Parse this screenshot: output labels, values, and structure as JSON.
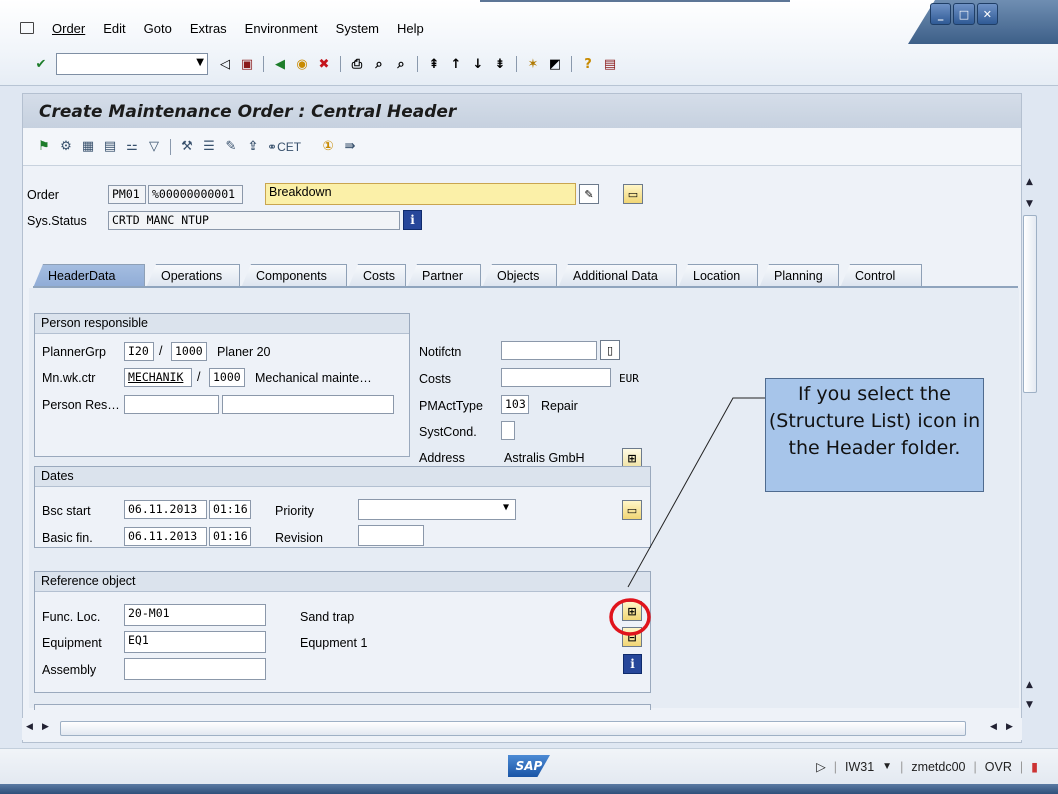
{
  "menu": {
    "items": [
      "Order",
      "Edit",
      "Goto",
      "Extras",
      "Environment",
      "System",
      "Help"
    ]
  },
  "title": "Create Maintenance Order : Central Header",
  "toolbar2": {
    "cet_label": "CET"
  },
  "header": {
    "order_label": "Order",
    "order_type": "PM01",
    "order_number": "%00000000001",
    "order_desc": "Breakdown",
    "sys_status_label": "Sys.Status",
    "sys_status": "CRTD MANC NTUP"
  },
  "tabs": [
    "HeaderData",
    "Operations",
    "Components",
    "Costs",
    "Partner",
    "Objects",
    "Additional Data",
    "Location",
    "Planning",
    "Control"
  ],
  "person_responsible": {
    "title": "Person responsible",
    "planner_grp_label": "PlannerGrp",
    "planner_grp": "I20",
    "planner_plant": "1000",
    "planner_text": "Planer 20",
    "mn_wk_ctr_label": "Mn.wk.ctr",
    "mn_wk_ctr": "MECHANIK",
    "mn_wk_plant": "1000",
    "mn_wk_text": "Mechanical mainte…",
    "person_res_label": "Person Res…"
  },
  "right_fields": {
    "notifctn_label": "Notifctn",
    "costs_label": "Costs",
    "costs_currency": "EUR",
    "pmacttype_label": "PMActType",
    "pmacttype": "103",
    "pmacttype_text": "Repair",
    "systcond_label": "SystCond.",
    "address_label": "Address",
    "address_value": "Astralis GmbH"
  },
  "dates": {
    "title": "Dates",
    "bsc_start_label": "Bsc start",
    "bsc_start_date": "06.11.2013",
    "bsc_start_time": "01:16",
    "basic_fin_label": "Basic fin.",
    "basic_fin_date": "06.11.2013",
    "basic_fin_time": "01:16",
    "priority_label": "Priority",
    "revision_label": "Revision"
  },
  "reference_object": {
    "title": "Reference object",
    "func_loc_label": "Func. Loc.",
    "func_loc": "20-M01",
    "func_loc_text": "Sand trap",
    "equipment_label": "Equipment",
    "equipment": "EQ1",
    "equipment_text": "Equpment 1",
    "assembly_label": "Assembly"
  },
  "callout": {
    "text": "If you select the (Structure List) icon in the Header folder."
  },
  "statusbar": {
    "logo": "SAP",
    "transaction": "IW31",
    "server": "zmetdc00",
    "mode": "OVR"
  },
  "colors": {
    "highlight_circle": "#e0141c",
    "callout_bg": "#a7c5ea",
    "active_tab": "#8fabd6",
    "required_field": "#fbf0a8"
  }
}
